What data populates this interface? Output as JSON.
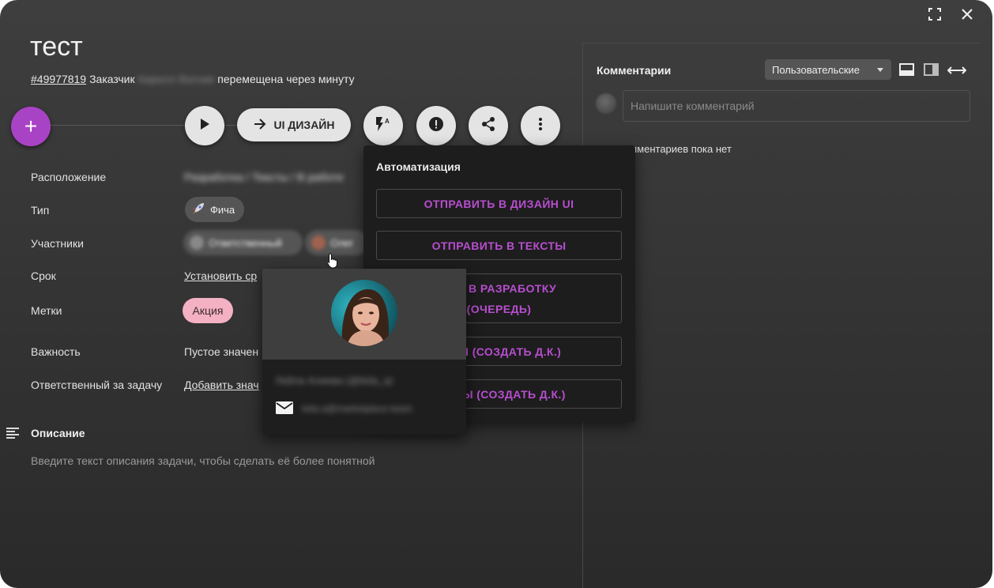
{
  "window": {
    "controls": [
      {
        "name": "fullscreen-icon"
      },
      {
        "name": "close-icon"
      }
    ]
  },
  "task": {
    "title": "тест",
    "id": "#49977819",
    "customer_label": "Заказчик",
    "customer_name": "Кирилл Ватник",
    "moved_text": "перемещена через минуту"
  },
  "toolbar": {
    "add_label": "+",
    "move_label": "UI ДИЗАЙН",
    "icons": [
      "play-icon",
      "arrow-right-icon",
      "automation-icon",
      "priority-icon",
      "share-icon",
      "more-vert-icon"
    ]
  },
  "properties": {
    "location_label": "Расположение",
    "location_value": "Разработка / Тексты / В работе",
    "type_label": "Тип",
    "type_value": "Фича",
    "participants_label": "Участники",
    "participant_1": "Ответственный",
    "participant_2": "Олег",
    "deadline_label": "Срок",
    "deadline_value": "Установить ср",
    "tags_label": "Метки",
    "tag_1": "Акция",
    "importance_label": "Важность",
    "importance_value": "Пустое значен",
    "assignee_label": "Ответственный за задачу",
    "assignee_value": "Добавить знач"
  },
  "description": {
    "title": "Описание",
    "placeholder": "Введите текст описания задачи, чтобы сделать её более понятной"
  },
  "comments": {
    "title": "Комментарии",
    "filter_value": "Пользовательские",
    "input_placeholder": "Напишите комментарий",
    "empty_text": "омментариев пока нет"
  },
  "automation": {
    "title": "Автоматизация",
    "buttons": [
      {
        "line1": "ОТПРАВИТЬ В ДИЗАЙН UI",
        "line2": ""
      },
      {
        "line1": "ОТПРАВИТЬ В ТЕКСТЫ",
        "line2": ""
      },
      {
        "line1": "ИТЬ В РАЗРАБОТКУ",
        "line2": "(ОЧЕРЕДЬ)"
      },
      {
        "line1": "ЗАЙН (СОЗДАТЬ Д.К.)",
        "line2": ""
      },
      {
        "line1": "ЕКСТЫ (СОЗДАТЬ Д.К.)",
        "line2": ""
      }
    ]
  },
  "profile_card": {
    "name": "Лейла Алиева (@leila_a)",
    "email": "leila.a@marketplace-team"
  },
  "colors": {
    "accent_purple": "#a943c6",
    "automation_text": "#b84ed0",
    "tag_pink": "#f4b1c3"
  }
}
